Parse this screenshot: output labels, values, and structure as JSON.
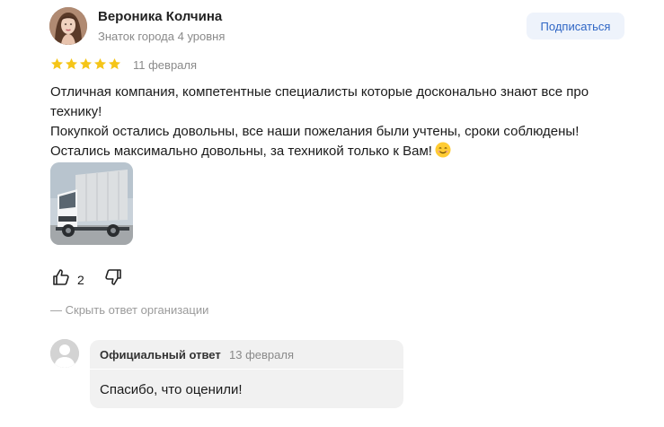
{
  "author": {
    "name": "Вероника Колчина",
    "level": "Знаток города 4 уровня"
  },
  "subscribe_label": "Подписаться",
  "rating": {
    "value": 5,
    "max": 5,
    "star_color": "#f5c518"
  },
  "review": {
    "date": "11 февраля",
    "lines": [
      "Отличная компания, компетентные специалисты которые досконально знают все про технику!",
      "Покупкой остались довольны, все наши пожелания были учтены, сроки соблюдены!",
      "Остались максимально довольны, за техникой только к Вам!"
    ]
  },
  "photo": {
    "icon": "truck-photo"
  },
  "reactions": {
    "likes": "2"
  },
  "hide_reply_label": "— Скрыть ответ организации",
  "org_reply": {
    "label": "Официальный ответ",
    "date": "13 февраля",
    "text": "Спасибо, что оценили!"
  },
  "colors": {
    "accent": "#2f66c5",
    "muted": "#8a8a8a",
    "reply_bg": "#f1f1f1"
  }
}
